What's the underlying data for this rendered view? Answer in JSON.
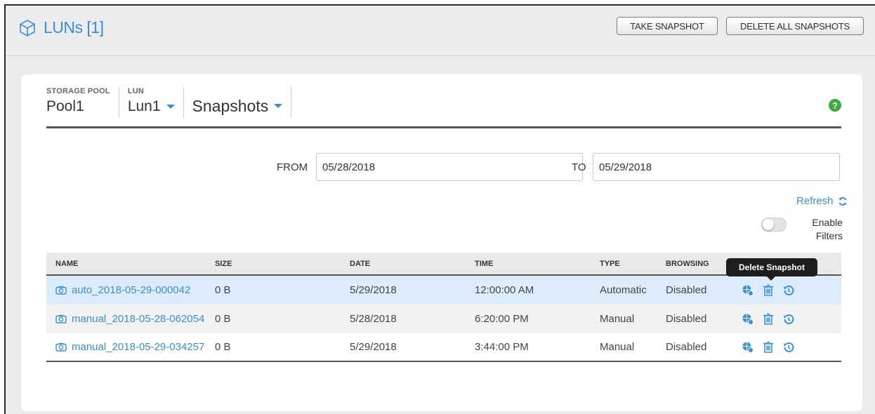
{
  "header": {
    "title": "LUNs [1]",
    "take_snapshot": "TAKE SNAPSHOT",
    "delete_all": "DELETE ALL SNAPSHOTS",
    "icon": "cube-icon"
  },
  "breadcrumb": {
    "pool_label": "STORAGE POOL",
    "pool_value": "Pool1",
    "lun_label": "LUN",
    "lun_value": "Lun1",
    "view_value": "Snapshots"
  },
  "help_icon": "?",
  "filter": {
    "from_label": "FROM",
    "from_value": "05/28/2018",
    "to_label": "TO",
    "to_value": "05/29/2018",
    "refresh_label": "Refresh",
    "enable_filters_label_1": "Enable",
    "enable_filters_label_2": "Filters"
  },
  "table": {
    "headers": [
      "NAME",
      "SIZE",
      "DATE",
      "TIME",
      "TYPE",
      "BROWSING"
    ],
    "rows": [
      {
        "name": "auto_2018-05-29-000042",
        "size": "0 B",
        "date": "5/29/2018",
        "time": "12:00:00 AM",
        "type": "Automatic",
        "browsing": "Disabled"
      },
      {
        "name": "manual_2018-05-28-062054",
        "size": "0 B",
        "date": "5/28/2018",
        "time": "6:20:00 PM",
        "type": "Manual",
        "browsing": "Disabled"
      },
      {
        "name": "manual_2018-05-29-034257",
        "size": "0 B",
        "date": "5/29/2018",
        "time": "3:44:00 PM",
        "type": "Manual",
        "browsing": "Disabled"
      }
    ]
  },
  "tooltip": "Delete Snapshot",
  "colors": {
    "accent": "#3a8ed6",
    "selected_row": "#dcecfb",
    "help": "#3cac3c"
  }
}
